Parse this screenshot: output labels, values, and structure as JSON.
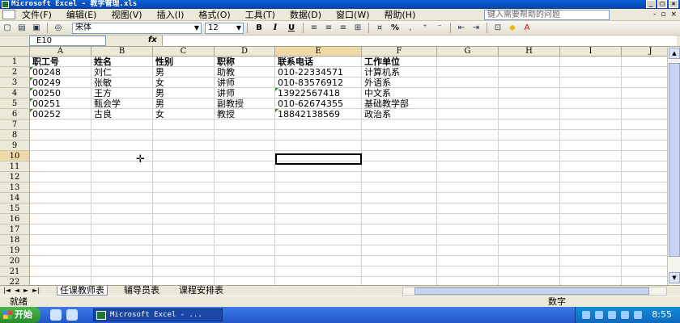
{
  "window": {
    "title": "Microsoft Excel - 教学管理.xls",
    "btn_min": "_",
    "btn_max": "□",
    "btn_close": "×"
  },
  "menu": {
    "items": [
      "文件(F)",
      "编辑(E)",
      "视图(V)",
      "插入(I)",
      "格式(O)",
      "工具(T)",
      "数据(D)",
      "窗口(W)",
      "帮助(H)"
    ],
    "help_placeholder": "键入需要帮助的问题",
    "right_btns": [
      "-",
      "▫",
      "×"
    ]
  },
  "toolbar": {
    "font_name": "宋体",
    "font_size": "12",
    "bold": "B",
    "italic": "I",
    "underline": "U",
    "percent": "%"
  },
  "formula": {
    "name_box": "E10",
    "fx": "fx",
    "content": ""
  },
  "columns": [
    "A",
    "B",
    "C",
    "D",
    "E",
    "F",
    "G",
    "H",
    "I",
    "J"
  ],
  "selected_column": "E",
  "selected_row": 10,
  "rows": [
    "1",
    "2",
    "3",
    "4",
    "5",
    "6",
    "7",
    "8",
    "9",
    "10",
    "11",
    "12",
    "13",
    "14",
    "15",
    "16",
    "17",
    "18",
    "19",
    "20",
    "21",
    "22"
  ],
  "table": {
    "headers": [
      "职工号",
      "姓名",
      "性别",
      "职称",
      "联系电话",
      "工作单位"
    ],
    "records": [
      [
        "00248",
        "刘仁",
        "男",
        "助教",
        "010-22334571",
        "计算机系"
      ],
      [
        "00249",
        "张敏",
        "女",
        "讲师",
        "010-83576912",
        "外语系"
      ],
      [
        "00250",
        "王方",
        "男",
        "讲师",
        "13922567418",
        "中文系"
      ],
      [
        "00251",
        "甄会学",
        "男",
        "副教授",
        "010-62674355",
        "基础教学部"
      ],
      [
        "00252",
        "古良",
        "女",
        "教授",
        "18842138569",
        "政治系"
      ]
    ]
  },
  "sheets": {
    "tabs": [
      "任课教师表",
      "辅导员表",
      "课程安排表"
    ],
    "active": 0
  },
  "status": {
    "left": "就绪",
    "mode": "数字"
  },
  "taskbar": {
    "start_label": "开始",
    "task_title": "Microsoft Excel - ...",
    "clock": "8:55"
  },
  "colors": {
    "title_bar": "#0842a8",
    "selected_header": "#f0d8a8",
    "text_triangle": "#2a8a2a",
    "taskbar": "#1f55c8"
  }
}
